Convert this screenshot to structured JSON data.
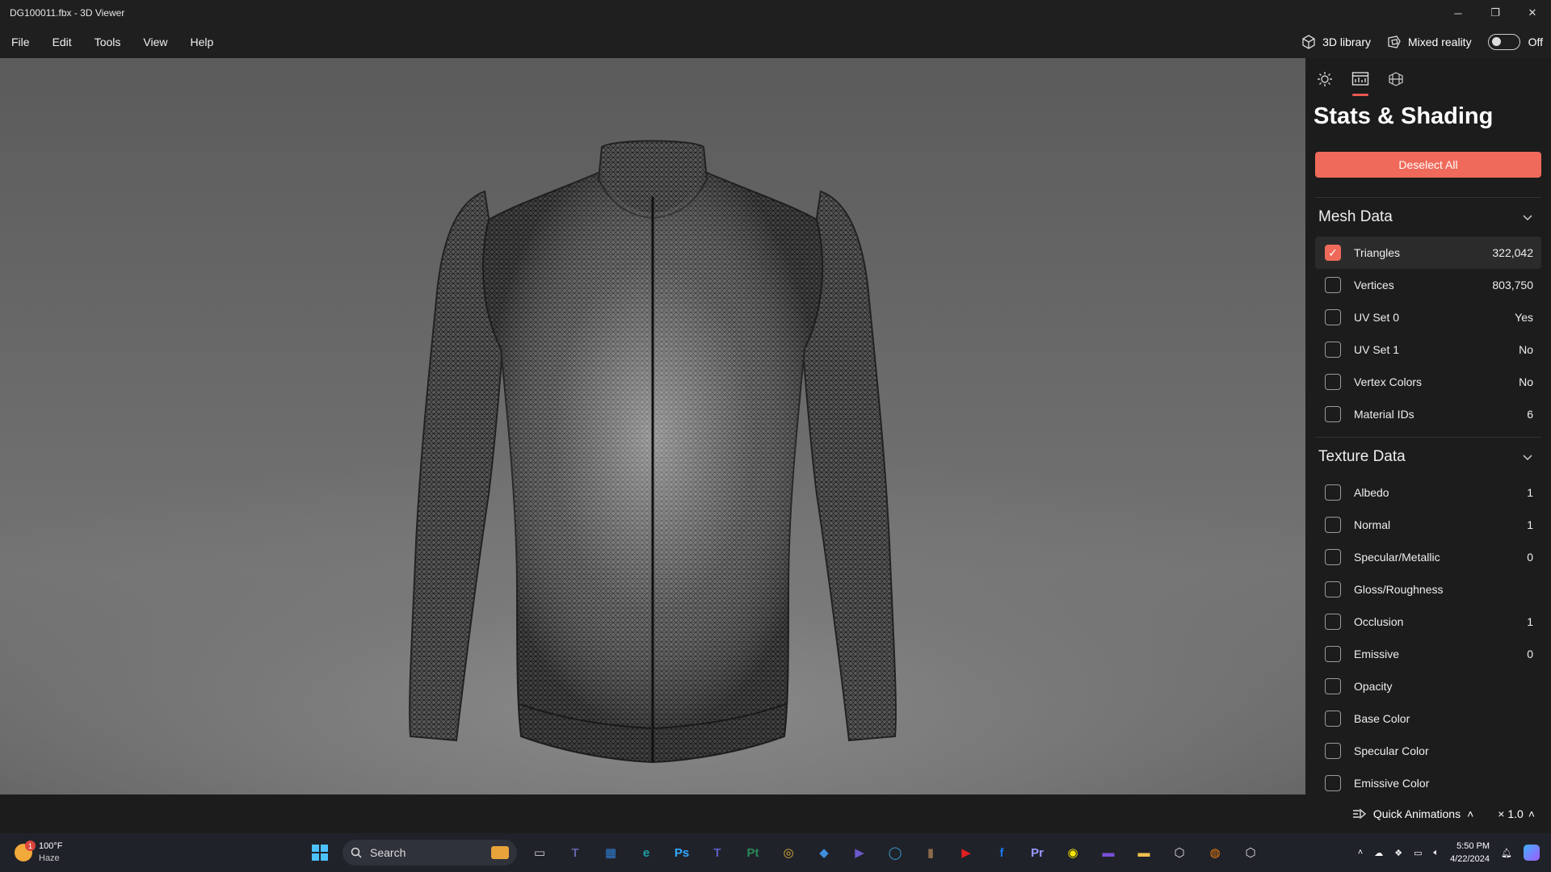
{
  "window": {
    "title": "DG100011.fbx - 3D Viewer",
    "min": "─",
    "max": "❐",
    "close": "✕"
  },
  "menu": {
    "items": [
      "File",
      "Edit",
      "Tools",
      "View",
      "Help"
    ],
    "library_label": "3D library",
    "mixed_reality_label": "Mixed reality",
    "toggle_state": "Off"
  },
  "panel": {
    "title": "Stats & Shading",
    "deselect_label": "Deselect All",
    "mesh_section": "Mesh Data",
    "mesh_rows": [
      {
        "name": "Triangles",
        "value": "322,042",
        "checked": true
      },
      {
        "name": "Vertices",
        "value": "803,750",
        "checked": false
      },
      {
        "name": "UV Set 0",
        "value": "Yes",
        "checked": false
      },
      {
        "name": "UV Set 1",
        "value": "No",
        "checked": false
      },
      {
        "name": "Vertex Colors",
        "value": "No",
        "checked": false
      },
      {
        "name": "Material IDs",
        "value": "6",
        "checked": false
      }
    ],
    "texture_section": "Texture Data",
    "texture_rows": [
      {
        "name": "Albedo",
        "value": "1"
      },
      {
        "name": "Normal",
        "value": "1"
      },
      {
        "name": "Specular/Metallic",
        "value": "0"
      },
      {
        "name": "Gloss/Roughness",
        "value": ""
      },
      {
        "name": "Occlusion",
        "value": "1"
      },
      {
        "name": "Emissive",
        "value": "0"
      },
      {
        "name": "Opacity",
        "value": ""
      },
      {
        "name": "Base Color",
        "value": ""
      },
      {
        "name": "Specular Color",
        "value": ""
      },
      {
        "name": "Emissive Color",
        "value": ""
      }
    ]
  },
  "bottom": {
    "quick_animations": "Quick Animations",
    "speed": "× 1.0"
  },
  "taskbar": {
    "temp": "100°F",
    "condition": "Haze",
    "badge": "1",
    "search_label": "Search",
    "apps": [
      {
        "name": "start",
        "label": "",
        "color": "#3aa0ff"
      },
      {
        "name": "task-view",
        "label": "▭",
        "color": "#cccccc"
      },
      {
        "name": "teams-chat",
        "label": "T",
        "color": "#6264a7"
      },
      {
        "name": "store",
        "label": "▦",
        "color": "#2d7dd2"
      },
      {
        "name": "edge",
        "label": "e",
        "color": "#1ca0a8"
      },
      {
        "name": "photoshop",
        "label": "Ps",
        "color": "#31a8ff"
      },
      {
        "name": "teams",
        "label": "T",
        "color": "#5b5fc7"
      },
      {
        "name": "painter",
        "label": "Pt",
        "color": "#2a8a5a"
      },
      {
        "name": "chrome",
        "label": "◎",
        "color": "#e0b03a"
      },
      {
        "name": "maps",
        "label": "◆",
        "color": "#3f8fe0"
      },
      {
        "name": "app-blue",
        "label": "▶",
        "color": "#6a5acd"
      },
      {
        "name": "app-circle",
        "label": "◯",
        "color": "#3aa0d8"
      },
      {
        "name": "photo",
        "label": "▮",
        "color": "#8a6a4a"
      },
      {
        "name": "youtube",
        "label": "▶",
        "color": "#e02020"
      },
      {
        "name": "facebook",
        "label": "f",
        "color": "#1877f2"
      },
      {
        "name": "premiere",
        "label": "Pr",
        "color": "#9999ff"
      },
      {
        "name": "snapchat",
        "label": "◉",
        "color": "#f5e400"
      },
      {
        "name": "clipchamp",
        "label": "▬",
        "color": "#7a4fd6"
      },
      {
        "name": "explorer",
        "label": "▬",
        "color": "#f2c14e"
      },
      {
        "name": "app-hex",
        "label": "⬡",
        "color": "#dddddd"
      },
      {
        "name": "blender",
        "label": "◍",
        "color": "#e87d0d"
      },
      {
        "name": "3d-viewer",
        "label": "⬡",
        "color": "#dddddd"
      }
    ],
    "time": "5:50 PM",
    "date": "4/22/2024"
  }
}
